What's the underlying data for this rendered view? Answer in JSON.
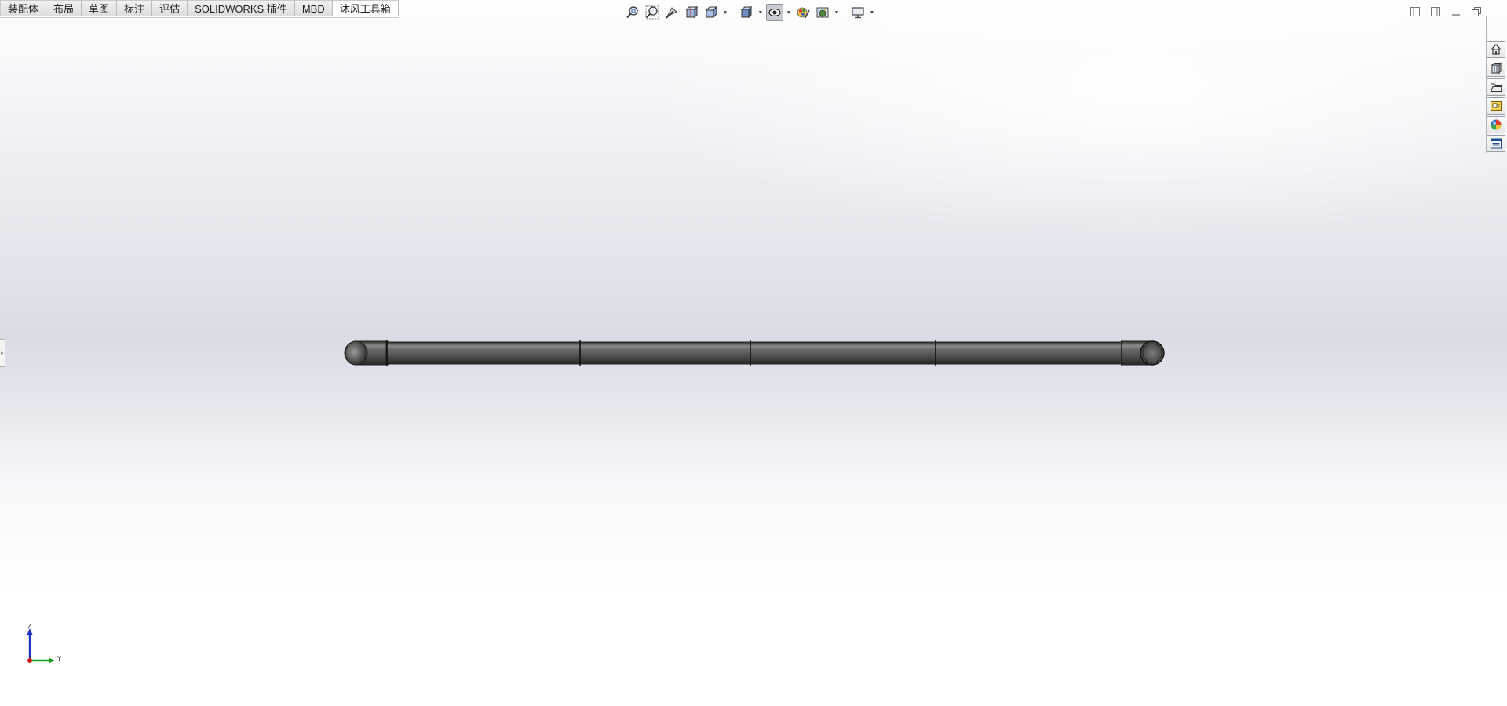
{
  "tabs": [
    {
      "label": "装配体",
      "active": false
    },
    {
      "label": "布局",
      "active": false
    },
    {
      "label": "草图",
      "active": false
    },
    {
      "label": "标注",
      "active": false
    },
    {
      "label": "评估",
      "active": false
    },
    {
      "label": "SOLIDWORKS 插件",
      "active": false
    },
    {
      "label": "MBD",
      "active": false
    },
    {
      "label": "沐风工具箱",
      "active": true
    }
  ],
  "heads_up_toolbar": [
    "zoom-to-fit-icon",
    "zoom-to-area-icon",
    "previous-view-icon",
    "section-view-icon",
    "view-orientation-icon",
    "display-style-icon",
    "hide-show-items-icon",
    "edit-appearance-icon",
    "apply-scene-icon",
    "view-settings-icon"
  ],
  "window_controls": [
    "tile-left-icon",
    "tile-right-icon",
    "minimize-icon",
    "restore-icon"
  ],
  "task_pane": [
    "solidworks-resources-icon",
    "design-library-icon",
    "file-explorer-icon",
    "view-palette-icon",
    "appearances-scenes-icon",
    "custom-properties-icon"
  ],
  "triad": {
    "z_label": "Z",
    "y_label": "Y"
  },
  "colors": {
    "accent_pressed": "#c9ccd3",
    "model_body": "#5a5a5a",
    "axis_z": "#1f2fbf",
    "axis_y": "#1a9a1a",
    "axis_x": "#d01818"
  }
}
